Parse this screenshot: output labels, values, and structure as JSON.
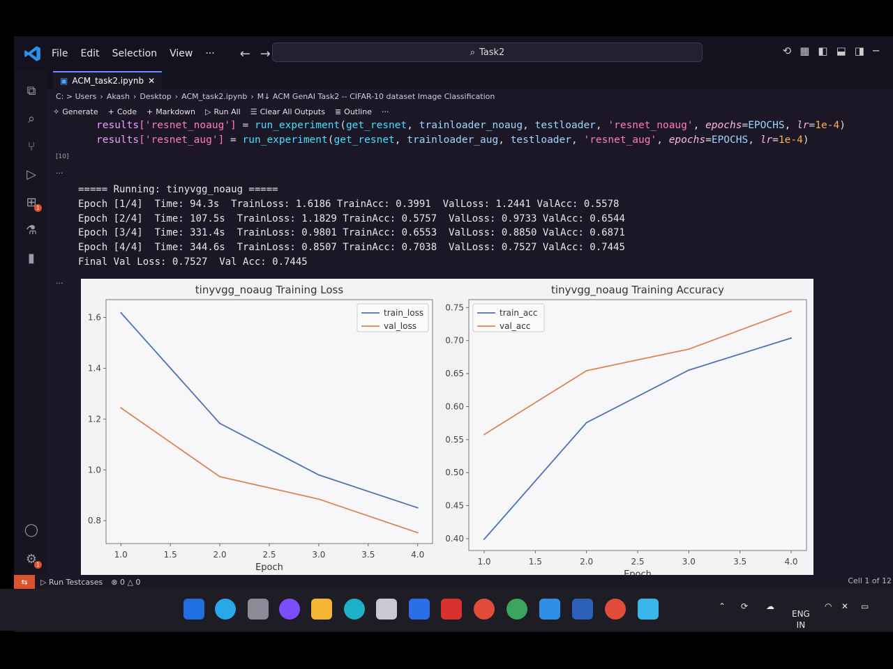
{
  "menu": {
    "file": "File",
    "edit": "Edit",
    "selection": "Selection",
    "view": "View",
    "more": "···"
  },
  "search": {
    "text": "Task2"
  },
  "tab": {
    "name": "ACM_task2.ipynb",
    "close": "✕"
  },
  "breadcrumb": [
    "C: > Users",
    "Akash",
    "Desktop",
    "ACM_task2.ipynb",
    "M↓ ACM GenAI Task2 -- CIFAR-10 dataset Image Classification"
  ],
  "toolbar": {
    "generate": "Generate",
    "code": "Code",
    "markdown": "Markdown",
    "run_all": "Run All",
    "clear_outputs": "Clear All Outputs",
    "outline": "Outline",
    "more": "···"
  },
  "code_lines": [
    {
      "var": "results",
      "key": "['resnet_noaug']",
      "eq": " = ",
      "fn": "run_experiment",
      "args": [
        "get_resnet",
        "trainloader_noaug",
        "testloader"
      ],
      "name": "'resnet_noaug'",
      "kw1": "epochs",
      "v1": "EPOCHS",
      "kw2": "lr",
      "v2": "1e-4"
    },
    {
      "var": "results",
      "key": "['resnet_aug']",
      "eq": " = ",
      "fn": "run_experiment",
      "args": [
        "get_resnet",
        "trainloader_aug",
        "testloader"
      ],
      "name": "'resnet_aug'",
      "kw1": "epochs",
      "v1": "EPOCHS",
      "kw2": "lr",
      "v2": "1e-4"
    }
  ],
  "exec_count": "[10]",
  "output_lines": [
    "===== Running: tinyvgg_noaug =====",
    "Epoch [1/4]  Time: 94.3s  TrainLoss: 1.6186 TrainAcc: 0.3991  ValLoss: 1.2441 ValAcc: 0.5578",
    "Epoch [2/4]  Time: 107.5s  TrainLoss: 1.1829 TrainAcc: 0.5757  ValLoss: 0.9733 ValAcc: 0.6544",
    "Epoch [3/4]  Time: 331.4s  TrainLoss: 0.9801 TrainAcc: 0.6553  ValLoss: 0.8850 ValAcc: 0.6871",
    "Epoch [4/4]  Time: 344.6s  TrainLoss: 0.8507 TrainAcc: 0.7038  ValLoss: 0.7527 ValAcc: 0.7445",
    "Final Val Loss: 0.7527  Val Acc: 0.7445"
  ],
  "chart_data": [
    {
      "type": "line",
      "title": "tinyvgg_noaug Training Loss",
      "xlabel": "Epoch",
      "ylabel": "",
      "x": [
        1,
        2,
        3,
        4
      ],
      "series": [
        {
          "name": "train_loss",
          "values": [
            1.6186,
            1.1829,
            0.9801,
            0.8507
          ],
          "color": "#4c72b0"
        },
        {
          "name": "val_loss",
          "values": [
            1.2441,
            0.9733,
            0.885,
            0.7527
          ],
          "color": "#dd8452"
        }
      ],
      "xlim": [
        0.85,
        4.15
      ],
      "ylim": [
        0.71,
        1.67
      ],
      "xticks": [
        "1.0",
        "1.5",
        "2.0",
        "2.5",
        "3.0",
        "3.5",
        "4.0"
      ],
      "yticks": [
        "0.8",
        "1.0",
        "1.2",
        "1.4",
        "1.6"
      ],
      "legend": "top-right"
    },
    {
      "type": "line",
      "title": "tinyvgg_noaug Training Accuracy",
      "xlabel": "Epoch",
      "ylabel": "",
      "x": [
        1,
        2,
        3,
        4
      ],
      "series": [
        {
          "name": "train_acc",
          "values": [
            0.3991,
            0.5757,
            0.6553,
            0.7038
          ],
          "color": "#4c72b0"
        },
        {
          "name": "val_acc",
          "values": [
            0.5578,
            0.6544,
            0.6871,
            0.7445
          ],
          "color": "#dd8452"
        }
      ],
      "xlim": [
        0.85,
        4.15
      ],
      "ylim": [
        0.382,
        0.762
      ],
      "xticks": [
        "1.0",
        "1.5",
        "2.0",
        "2.5",
        "3.0",
        "3.5",
        "4.0"
      ],
      "yticks": [
        "0.40",
        "0.45",
        "0.50",
        "0.55",
        "0.60",
        "0.65",
        "0.70",
        "0.75"
      ],
      "legend": "top-left"
    }
  ],
  "status": {
    "run_testcases": "Run Testcases",
    "problems": "⊗ 0 △ 0",
    "cell": "Cell 1 of 12"
  },
  "taskbar": {
    "lang": "ENG",
    "region": "IN"
  },
  "colors": {
    "accent": "#6c8cff",
    "remote": "#d9532e"
  }
}
